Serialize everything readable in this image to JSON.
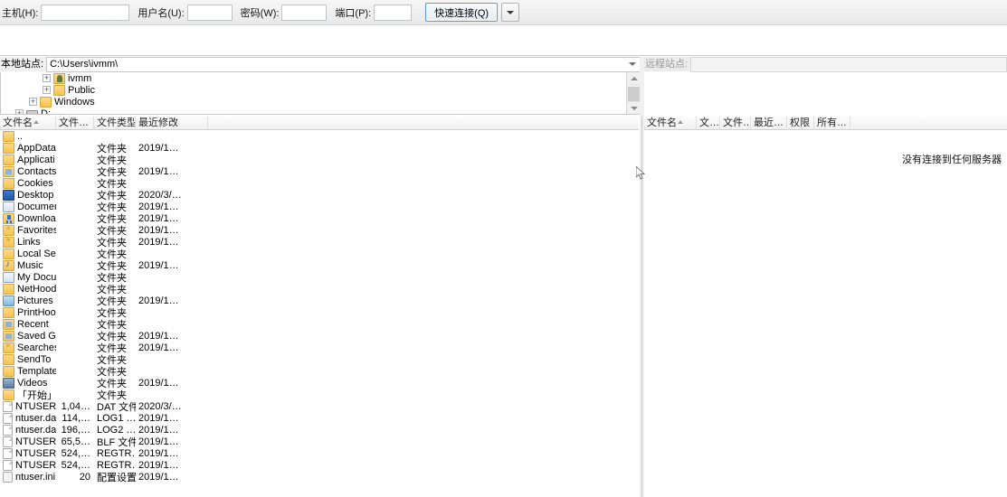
{
  "toolbar": {
    "host_label": "主机(H):",
    "host_value": "",
    "user_label": "用户名(U):",
    "user_value": "",
    "pass_label": "密码(W):",
    "pass_value": "",
    "port_label": "端口(P):",
    "port_value": "",
    "quickconnect_label": "快速连接(Q)",
    "dropdown_icon": "chevron-down-icon",
    "accent": "#4f9fe0"
  },
  "local_site": {
    "label": "本地站点:",
    "path": "C:\\Users\\ivmm\\",
    "tree": [
      {
        "label": "ivmm",
        "indent": 46,
        "icon": "user-folder-icon",
        "expander": "+"
      },
      {
        "label": "Public",
        "indent": 46,
        "icon": "folder-icon",
        "expander": "+"
      },
      {
        "label": "Windows",
        "indent": 31,
        "icon": "folder-icon",
        "expander": "+"
      },
      {
        "label": "D:",
        "indent": 16,
        "icon": "drive-icon",
        "expander": "+"
      }
    ]
  },
  "remote_site": {
    "label": "远程站点:",
    "path": "",
    "empty_message": "没有连接到任何服务器"
  },
  "local_list": {
    "columns": [
      "文件名",
      "文件…",
      "文件类型",
      "最近修改"
    ],
    "rows": [
      {
        "name": "..",
        "size": "",
        "type": "",
        "date": "",
        "icon": "folder-icon"
      },
      {
        "name": "AppData",
        "size": "",
        "type": "文件夹",
        "date": "2019/1…",
        "icon": "folder-icon"
      },
      {
        "name": "Applicati…",
        "size": "",
        "type": "文件夹",
        "date": "",
        "icon": "folder-icon"
      },
      {
        "name": "Contacts",
        "size": "",
        "type": "文件夹",
        "date": "2019/1…",
        "icon": "contacts-icon"
      },
      {
        "name": "Cookies",
        "size": "",
        "type": "文件夹",
        "date": "",
        "icon": "folder-icon"
      },
      {
        "name": "Desktop",
        "size": "",
        "type": "文件夹",
        "date": "2020/3/…",
        "icon": "desktop-icon"
      },
      {
        "name": "Documen…",
        "size": "",
        "type": "文件夹",
        "date": "2019/1…",
        "icon": "documents-icon"
      },
      {
        "name": "Downloads",
        "size": "",
        "type": "文件夹",
        "date": "2019/1…",
        "icon": "downloads-icon"
      },
      {
        "name": "Favorites",
        "size": "",
        "type": "文件夹",
        "date": "2019/1…",
        "icon": "favorites-icon"
      },
      {
        "name": "Links",
        "size": "",
        "type": "文件夹",
        "date": "2019/1…",
        "icon": "links-icon"
      },
      {
        "name": "Local Sett…",
        "size": "",
        "type": "文件夹",
        "date": "",
        "icon": "folder-icon"
      },
      {
        "name": "Music",
        "size": "",
        "type": "文件夹",
        "date": "2019/1…",
        "icon": "music-icon"
      },
      {
        "name": "My Docu…",
        "size": "",
        "type": "文件夹",
        "date": "",
        "icon": "documents-icon"
      },
      {
        "name": "NetHood",
        "size": "",
        "type": "文件夹",
        "date": "",
        "icon": "folder-icon"
      },
      {
        "name": "Pictures",
        "size": "",
        "type": "文件夹",
        "date": "2019/1…",
        "icon": "pictures-icon"
      },
      {
        "name": "PrintHood",
        "size": "",
        "type": "文件夹",
        "date": "",
        "icon": "folder-icon"
      },
      {
        "name": "Recent",
        "size": "",
        "type": "文件夹",
        "date": "",
        "icon": "recent-icon"
      },
      {
        "name": "Saved Ga…",
        "size": "",
        "type": "文件夹",
        "date": "2019/1…",
        "icon": "savedgames-icon"
      },
      {
        "name": "Searches",
        "size": "",
        "type": "文件夹",
        "date": "2019/1…",
        "icon": "searches-icon"
      },
      {
        "name": "SendTo",
        "size": "",
        "type": "文件夹",
        "date": "",
        "icon": "folder-icon"
      },
      {
        "name": "Templates",
        "size": "",
        "type": "文件夹",
        "date": "",
        "icon": "folder-icon"
      },
      {
        "name": "Videos",
        "size": "",
        "type": "文件夹",
        "date": "2019/1…",
        "icon": "video-icon"
      },
      {
        "name": "「开始」…",
        "size": "",
        "type": "文件夹",
        "date": "",
        "icon": "folder-icon"
      },
      {
        "name": "NTUSER…",
        "size": "1,04…",
        "type": "DAT 文件",
        "date": "2020/3/…",
        "icon": "file-icon"
      },
      {
        "name": "ntuser.da…",
        "size": "114,…",
        "type": "LOG1 …",
        "date": "2019/1…",
        "icon": "file-icon"
      },
      {
        "name": "ntuser.da…",
        "size": "196,…",
        "type": "LOG2 …",
        "date": "2019/1…",
        "icon": "file-icon"
      },
      {
        "name": "NTUSER…",
        "size": "65,5…",
        "type": "BLF 文件",
        "date": "2019/1…",
        "icon": "file-icon"
      },
      {
        "name": "NTUSER…",
        "size": "524,…",
        "type": "REGTR…",
        "date": "2019/1…",
        "icon": "file-icon"
      },
      {
        "name": "NTUSER…",
        "size": "524,…",
        "type": "REGTR…",
        "date": "2019/1…",
        "icon": "file-icon"
      },
      {
        "name": "ntuser.ini",
        "size": "20",
        "type": "配置设置",
        "date": "2019/1…",
        "icon": "ini-icon"
      }
    ]
  },
  "remote_list": {
    "columns": [
      "文件名",
      "文…",
      "文件…",
      "最近…",
      "权限",
      "所有…"
    ]
  }
}
